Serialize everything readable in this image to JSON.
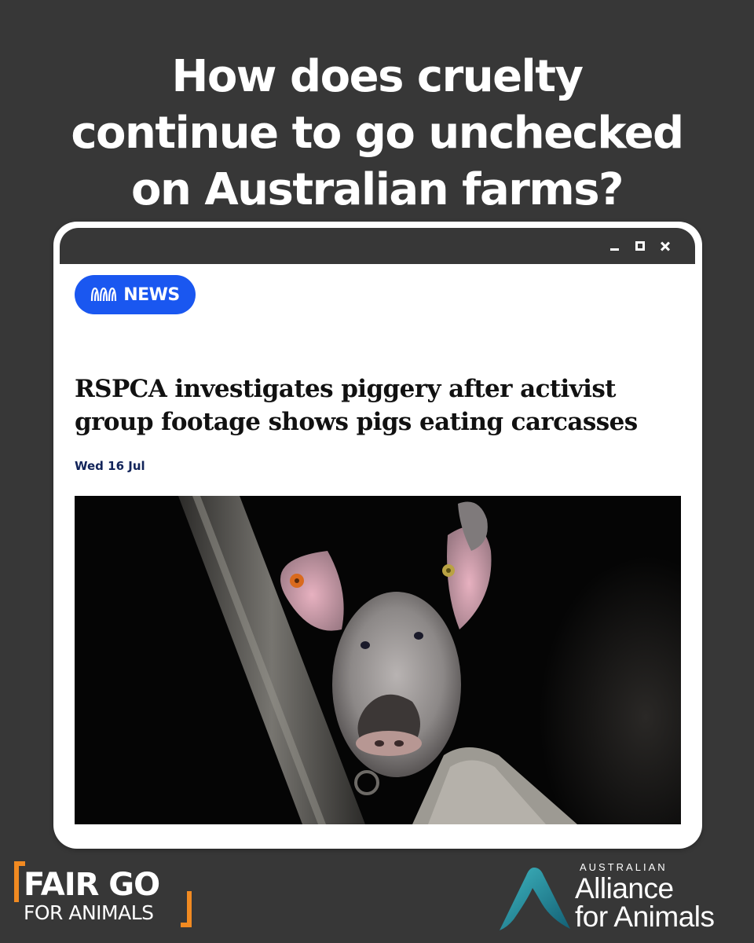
{
  "headline": {
    "lines": [
      "How does cruelty",
      "continue to go unchecked",
      "on Australian farms?"
    ]
  },
  "window": {
    "controls": [
      "minimize-icon",
      "maximize-icon",
      "close-icon"
    ]
  },
  "article": {
    "source_badge": "NEWS",
    "source_logo": "abc-logo",
    "title_lines": [
      "RSPCA investigates piggery after activist",
      "group footage shows pigs eating carcasses"
    ],
    "date": "Wed 16 Jul",
    "image": "pig-in-pen-photo"
  },
  "brand_left": {
    "line1": "FAIR GO",
    "line2": "FOR ANIMALS",
    "accent_color": "#f18a21"
  },
  "brand_right": {
    "top": "AUSTRALIAN",
    "line1": "Alliance",
    "line2": "for Animals",
    "accent_color": "#1e9aa8"
  },
  "colors": {
    "background": "#373737",
    "badge": "#1a57f0",
    "date_text": "#12245a"
  }
}
